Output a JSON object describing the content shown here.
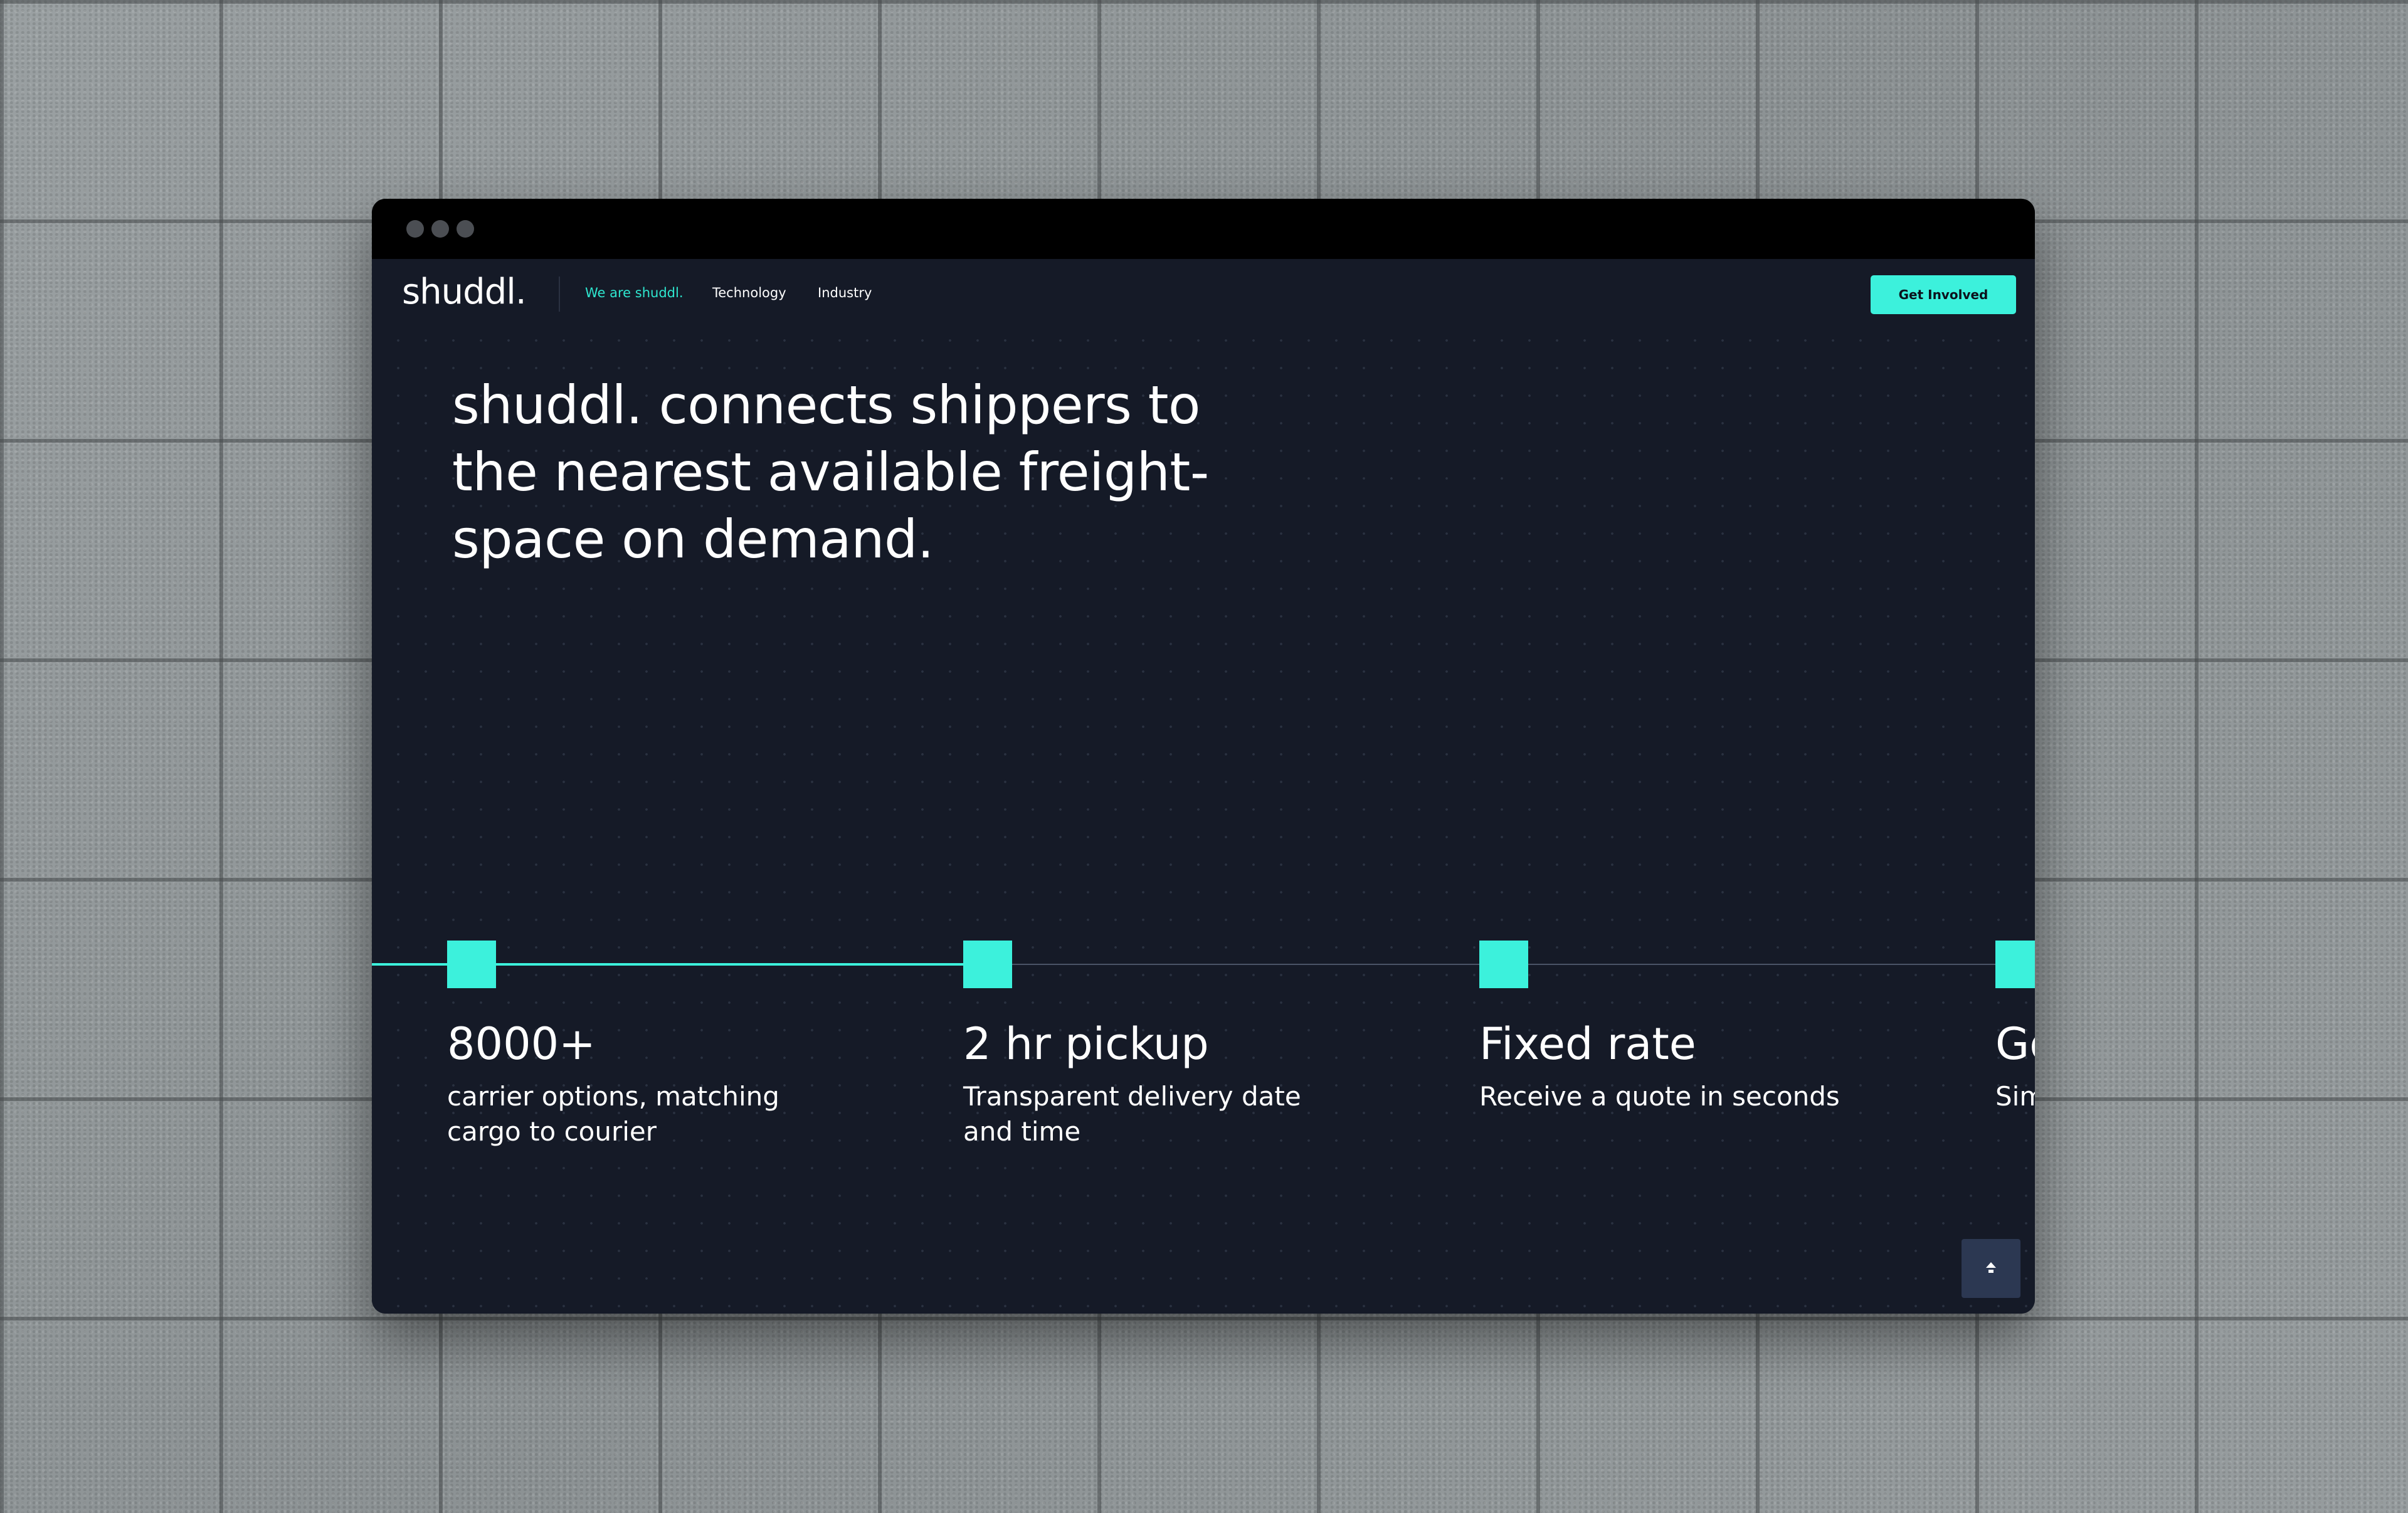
{
  "brand": {
    "logo_text": "shuddl.",
    "accent_color": "#3cf1dc"
  },
  "nav": {
    "links": [
      {
        "label": "We are shuddl.",
        "active": true
      },
      {
        "label": "Technology",
        "active": false
      },
      {
        "label": "Industry",
        "active": false
      }
    ],
    "cta_label": "Get Involved"
  },
  "hero": {
    "headline": "shuddl. connects shippers to the nearest available freight-space on demand."
  },
  "features": [
    {
      "title": "8000+",
      "description": "carrier options, matching cargo to courier"
    },
    {
      "title": "2 hr pickup",
      "description": "Transparent delivery date and time"
    },
    {
      "title": "Fixed rate",
      "description": "Receive a quote in seconds"
    },
    {
      "title": "Go",
      "description": "Sim"
    }
  ],
  "controls": {
    "scroll_top_icon": "arrow-up-icon"
  }
}
